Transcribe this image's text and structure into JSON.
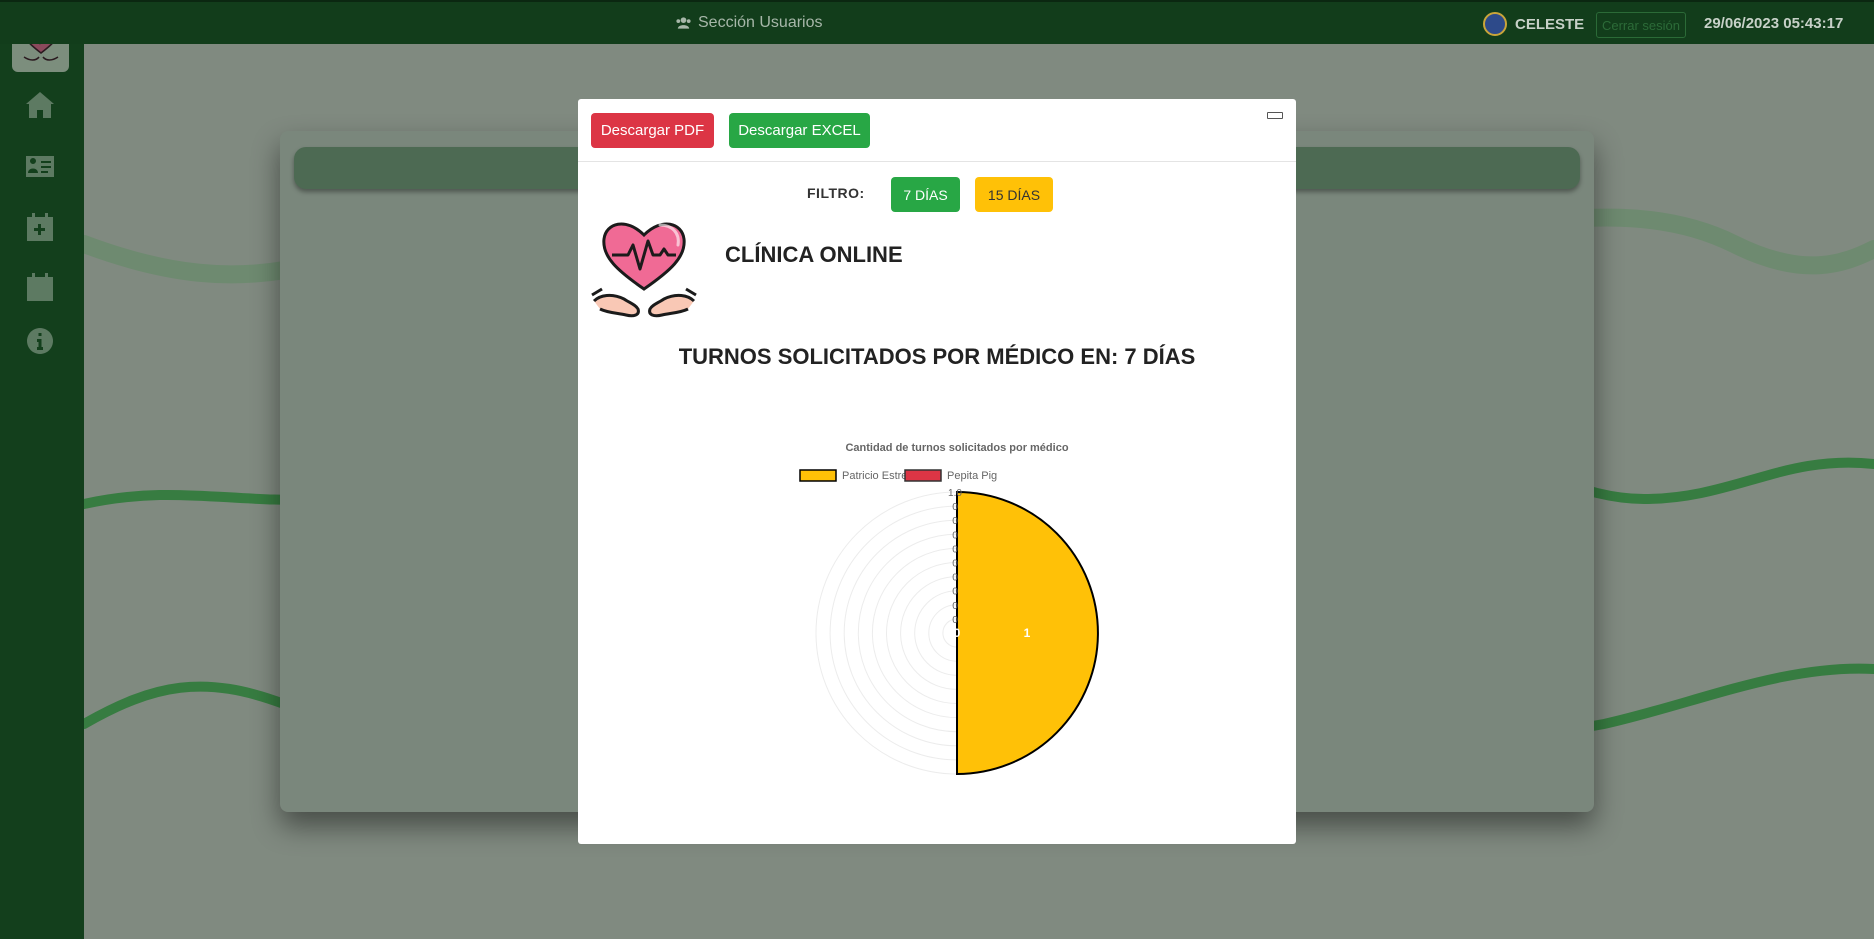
{
  "topbar": {
    "section_label": "Sección Usuarios",
    "section_icon": "users-icon",
    "user_name": "CELESTE",
    "logout_label": "Cerrar sesión",
    "datetime": "29/06/2023 05:43:17"
  },
  "sidebar": {
    "items": [
      {
        "icon": "home-icon"
      },
      {
        "icon": "id-card-icon"
      },
      {
        "icon": "calendar-plus-icon"
      },
      {
        "icon": "calendar-icon"
      },
      {
        "icon": "info-circle-icon"
      }
    ]
  },
  "modal": {
    "pdf_label": "Descargar PDF",
    "excel_label": "Descargar EXCEL",
    "filter_label": "FILTRO:",
    "filter_7_label": "7 DÍAS",
    "filter_15_label": "15 DÍAS",
    "clinic_name": "CLÍNICA ONLINE",
    "report_title": "TURNOS SOLICITADOS POR MÉDICO EN: 7 DÍAS"
  },
  "colors": {
    "danger": "#dc3545",
    "success": "#28a745",
    "warning": "#ffc107",
    "sidebar": "#133f1c"
  },
  "chart_data": {
    "type": "pie",
    "title": "Cantidad de turnos solicitados por médico",
    "categories": [
      "Patricio Estrella",
      "Pepita Pig"
    ],
    "values": [
      1,
      0
    ],
    "colors": [
      "#ffc107",
      "#dc3545"
    ],
    "slice_labels": [
      "1",
      "0"
    ],
    "radial_ticks": [
      "1.0",
      "0",
      "0",
      "0",
      "0",
      "0",
      "0",
      "0",
      "0",
      "0"
    ],
    "legend_position": "top"
  }
}
